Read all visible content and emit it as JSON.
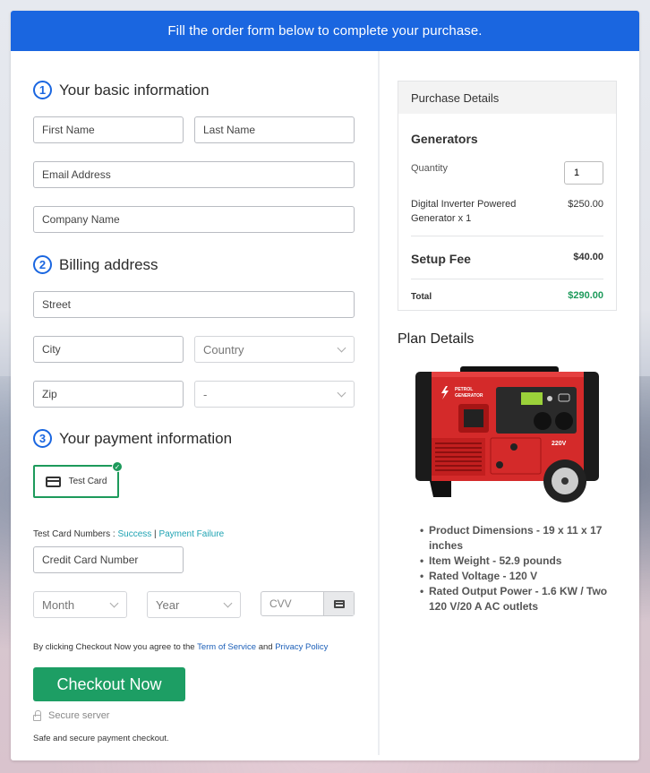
{
  "banner": {
    "text": "Fill the order form below to complete your purchase."
  },
  "sections": {
    "basic": {
      "number": "1",
      "title": "Your basic information"
    },
    "billing": {
      "number": "2",
      "title": "Billing address"
    },
    "payment": {
      "number": "3",
      "title": "Your payment information"
    }
  },
  "fields": {
    "first_name": {
      "placeholder": "First Name"
    },
    "last_name": {
      "placeholder": "Last Name"
    },
    "email": {
      "placeholder": "Email Address"
    },
    "company": {
      "placeholder": "Company Name"
    },
    "street": {
      "placeholder": "Street"
    },
    "city": {
      "placeholder": "City"
    },
    "country": {
      "selected": "Country"
    },
    "zip": {
      "placeholder": "Zip"
    },
    "state": {
      "selected": "-"
    },
    "card_number": {
      "placeholder": "Credit Card Number"
    },
    "month": {
      "selected": "Month"
    },
    "year": {
      "selected": "Year"
    },
    "cvv": {
      "placeholder": "CVV"
    }
  },
  "payment": {
    "method_label": "Test Card",
    "test_numbers_label": "Test Card Numbers : ",
    "success_link": "Success",
    "separator": " | ",
    "failure_link": "Payment Failure"
  },
  "terms": {
    "prefix": "By clicking Checkout Now you agree to the ",
    "tos_link": "Term of Service",
    "and": " and ",
    "privacy_link": "Privacy Policy"
  },
  "checkout": {
    "button_label": "Checkout Now",
    "secure_label": "Secure server",
    "safe_text": "Safe and secure payment checkout."
  },
  "purchase": {
    "header": "Purchase Details",
    "category": "Generators",
    "quantity_label": "Quantity",
    "quantity_value": "1",
    "item_name_line1": "Digital Inverter Powered",
    "item_name_line2": "Generator x 1",
    "item_price": "$250.00",
    "setup_fee_label": "Setup Fee",
    "setup_fee_value": "$40.00",
    "total_label": "Total",
    "total_value": "$290.00"
  },
  "plan": {
    "title": "Plan Details",
    "image_text_brand": "PETROL",
    "image_text_brand2": "GENERATOR",
    "image_text_voltage": "220V",
    "specs": [
      "Product Dimensions - 19 x 11 x 17 inches",
      "Item Weight - 52.9 pounds",
      "Rated Voltage - 120 V",
      "Rated Output Power - 1.6 KW / Two 120 V/20 A AC outlets"
    ]
  },
  "colors": {
    "primary": "#1a66e0",
    "success": "#1d9e64",
    "total": "#1d9a5b"
  }
}
